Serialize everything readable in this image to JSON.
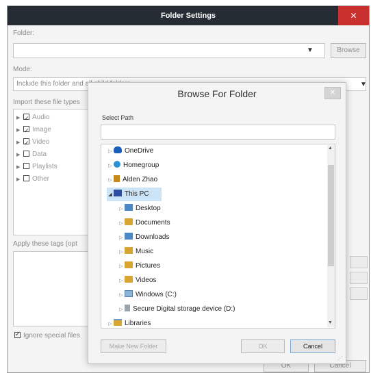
{
  "outer": {
    "title": "Folder Settings",
    "close": "✕",
    "folder_label": "Folder:",
    "folder_value": "",
    "browse_label": "Browse",
    "mode_label": "Mode:",
    "mode_value": "Include this folder and all child folders",
    "filetypes_label": "Import these file types",
    "filetypes": [
      {
        "label": "Audio",
        "checked": true
      },
      {
        "label": "Image",
        "checked": true
      },
      {
        "label": "Video",
        "checked": true
      },
      {
        "label": "Data",
        "checked": false
      },
      {
        "label": "Playlists",
        "checked": false
      },
      {
        "label": "Other",
        "checked": false
      }
    ],
    "tags_label": "Apply these tags (opt",
    "ignore_label": "Ignore special files",
    "ignore_checked": true,
    "ok_label": "OK",
    "cancel_label": "Cancel"
  },
  "modal": {
    "title": "Browse For Folder",
    "close": "✕",
    "select_path_label": "Select Path",
    "path_value": "",
    "tree": [
      {
        "label": "OneDrive",
        "icon": "onedrive-icon",
        "indent": 0,
        "expander": "collapsed"
      },
      {
        "label": "Homegroup",
        "icon": "homegroup-icon",
        "indent": 0,
        "expander": "collapsed"
      },
      {
        "label": "Alden Zhao",
        "icon": "user-folder-icon",
        "indent": 0,
        "expander": "collapsed"
      },
      {
        "label": "This PC",
        "icon": "computer-icon",
        "indent": 0,
        "expander": "expanded",
        "selected": true
      },
      {
        "label": "Desktop",
        "icon": "desktop-folder-icon",
        "indent": 1,
        "expander": "collapsed"
      },
      {
        "label": "Documents",
        "icon": "documents-folder-icon",
        "indent": 1,
        "expander": "collapsed"
      },
      {
        "label": "Downloads",
        "icon": "downloads-folder-icon",
        "indent": 1,
        "expander": "collapsed"
      },
      {
        "label": "Music",
        "icon": "music-folder-icon",
        "indent": 1,
        "expander": "collapsed"
      },
      {
        "label": "Pictures",
        "icon": "pictures-folder-icon",
        "indent": 1,
        "expander": "collapsed"
      },
      {
        "label": "Videos",
        "icon": "videos-folder-icon",
        "indent": 1,
        "expander": "collapsed"
      },
      {
        "label": "Windows (C:)",
        "icon": "drive-icon",
        "indent": 1,
        "expander": "collapsed"
      },
      {
        "label": "Secure Digital storage device (D:)",
        "icon": "sd-card-icon",
        "indent": 1,
        "expander": "collapsed"
      },
      {
        "label": "Libraries",
        "icon": "libraries-icon",
        "indent": 0,
        "expander": "collapsed"
      }
    ],
    "new_folder_label": "Make New Folder",
    "ok_label": "OK",
    "cancel_label": "Cancel"
  },
  "colors": {
    "title_bar": "#262c34",
    "close_red": "#c7302d",
    "selection": "#cde4f7",
    "accent": "#1c5fb8"
  }
}
